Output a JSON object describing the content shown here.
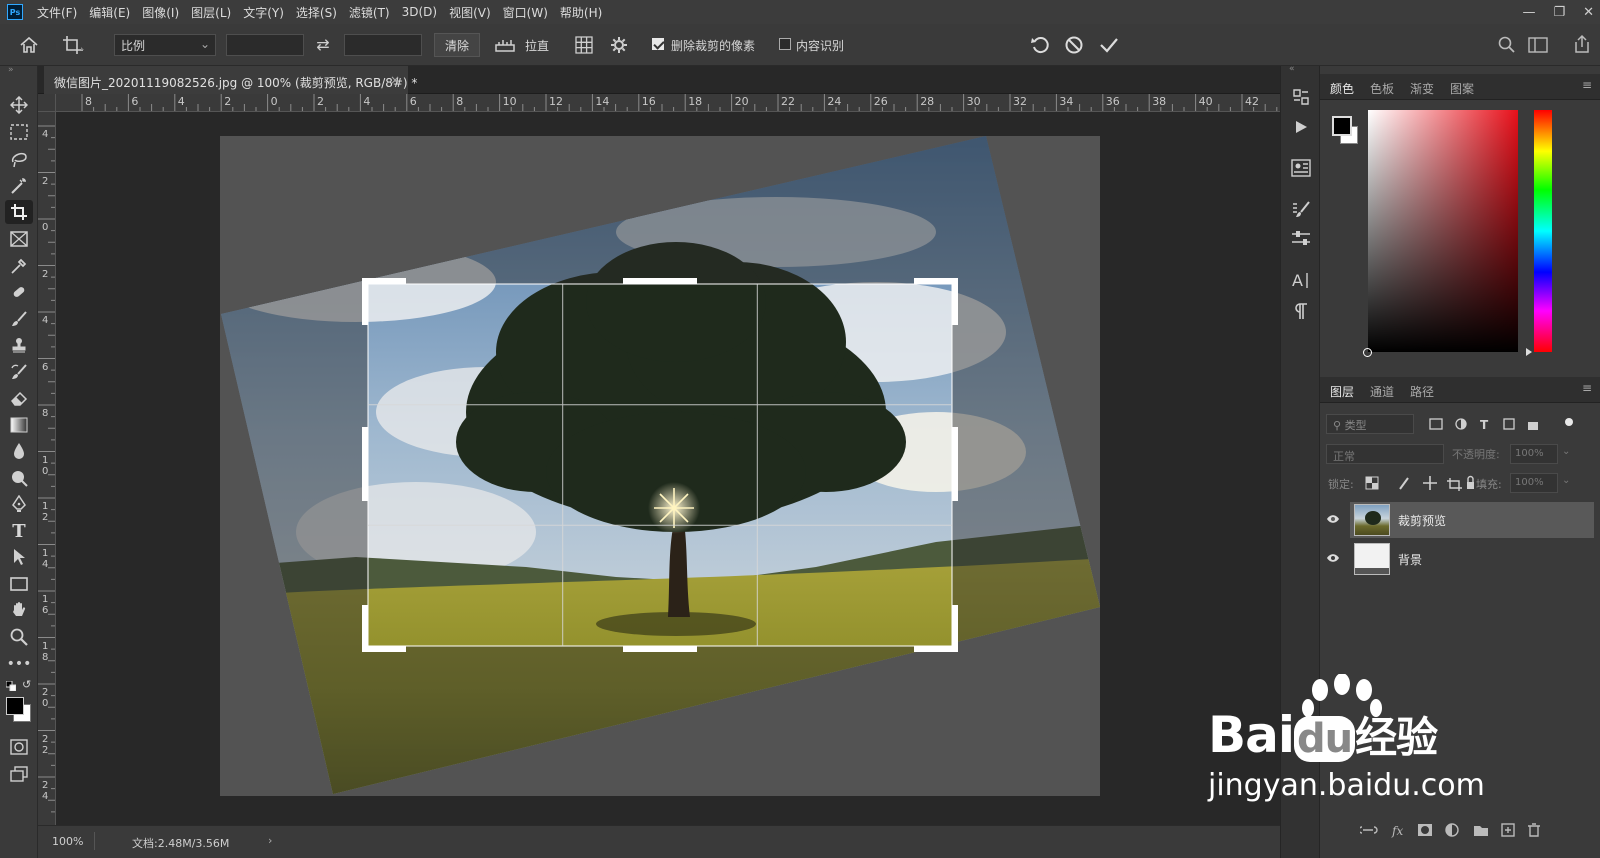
{
  "app": {
    "logo": "Ps"
  },
  "menu": [
    "文件(F)",
    "编辑(E)",
    "图像(I)",
    "图层(L)",
    "文字(Y)",
    "选择(S)",
    "滤镜(T)",
    "3D(D)",
    "视图(V)",
    "窗口(W)",
    "帮助(H)"
  ],
  "options": {
    "ratio_label": "比例",
    "clear_label": "清除",
    "straighten_label": "拉直",
    "delete_pixels_label": "删除裁剪的像素",
    "delete_pixels_checked": true,
    "content_aware_label": "内容识别",
    "content_aware_checked": false
  },
  "document": {
    "tab_title": "微信图片_20201119082526.jpg @ 100% (裁剪预览, RGB/8#) *",
    "zoom": "100%",
    "doc_info": "文档:2.48M/3.56M"
  },
  "rulers": {
    "top": [
      "8",
      "6",
      "4",
      "2",
      "0",
      "2",
      "4",
      "6",
      "8",
      "10",
      "12",
      "14",
      "16",
      "18",
      "20",
      "22",
      "24",
      "26",
      "28",
      "30",
      "32",
      "34",
      "36",
      "38",
      "40",
      "42"
    ],
    "left": [
      "4",
      "2",
      "0",
      "2",
      "4",
      "6",
      "8",
      "1 0",
      "1 2",
      "1 4",
      "1 6",
      "1 8",
      "2 0",
      "2 2",
      "2 4"
    ]
  },
  "color_panel": {
    "tabs": [
      "颜色",
      "色板",
      "渐变",
      "图案"
    ],
    "active_tab": "颜色",
    "foreground": "#000000",
    "background": "#ffffff",
    "hue_color": "#e8101a"
  },
  "layers_panel": {
    "tabs": [
      "图层",
      "通道",
      "路径"
    ],
    "active_tab": "图层",
    "filter_placeholder": "类型",
    "blend_mode": "正常",
    "opacity_label": "不透明度:",
    "opacity_value": "100%",
    "lock_label": "锁定:",
    "fill_label": "填充:",
    "fill_value": "100%",
    "layers": [
      {
        "name": "裁剪预览",
        "selected": true
      },
      {
        "name": "背景",
        "selected": false
      }
    ]
  },
  "watermark": {
    "brand": "Bai",
    "brand2": "du",
    "suffix": "经验",
    "url": "jingyan.baidu.com"
  }
}
